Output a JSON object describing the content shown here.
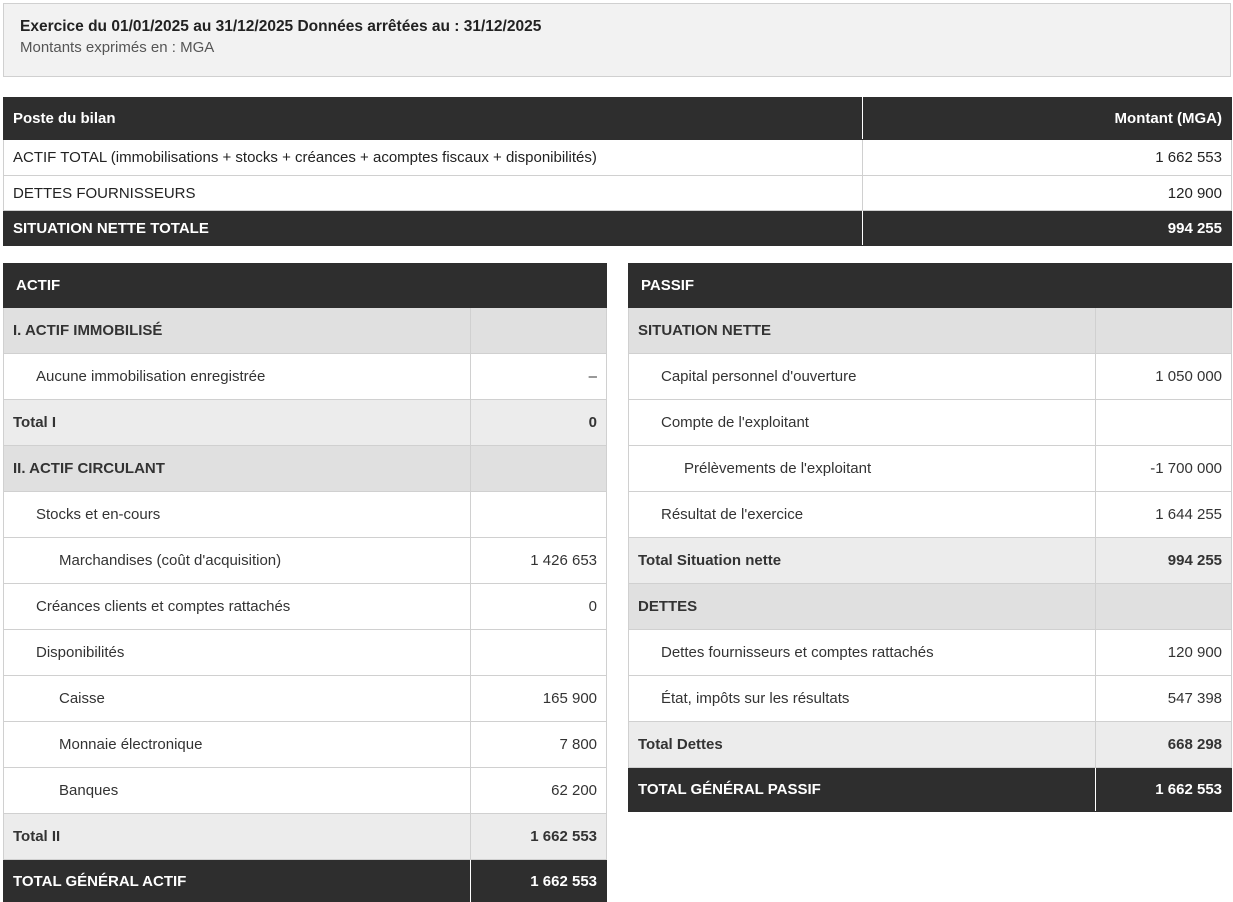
{
  "header": {
    "line1": "Exercice du 01/01/2025 au 31/12/2025 Données arrêtées au : 31/12/2025",
    "line2": "Montants exprimés en : MGA"
  },
  "summary": {
    "col_label": "Poste du bilan",
    "col_amount": "Montant (MGA)",
    "rows": [
      {
        "label": "ACTIF TOTAL (immobilisations + stocks + créances + acomptes fiscaux + disponibilités)",
        "amount": "1 662 553"
      },
      {
        "label": "DETTES FOURNISSEURS",
        "amount": "120 900"
      }
    ],
    "total": {
      "label": "SITUATION NETTE TOTALE",
      "amount": "994 255"
    }
  },
  "actif": {
    "title": "ACTIF",
    "rows": [
      {
        "label": "I. ACTIF IMMOBILISÉ",
        "amount": ""
      },
      {
        "label": "Aucune immobilisation enregistrée",
        "amount": "–"
      },
      {
        "label": "Total I",
        "amount": "0"
      },
      {
        "label": "II. ACTIF CIRCULANT",
        "amount": ""
      },
      {
        "label": "Stocks et en-cours",
        "amount": ""
      },
      {
        "label": "Marchandises (coût d'acquisition)",
        "amount": "1 426 653"
      },
      {
        "label": "Créances clients et comptes rattachés",
        "amount": "0"
      },
      {
        "label": "Disponibilités",
        "amount": ""
      },
      {
        "label": "Caisse",
        "amount": "165 900"
      },
      {
        "label": "Monnaie électronique",
        "amount": "7 800"
      },
      {
        "label": "Banques",
        "amount": "62 200"
      },
      {
        "label": "Total II",
        "amount": "1 662 553"
      },
      {
        "label": "TOTAL GÉNÉRAL ACTIF",
        "amount": "1 662 553"
      }
    ]
  },
  "passif": {
    "title": "PASSIF",
    "rows": [
      {
        "label": "SITUATION NETTE",
        "amount": ""
      },
      {
        "label": "Capital personnel d'ouverture",
        "amount": "1 050 000"
      },
      {
        "label": "Compte de l'exploitant",
        "amount": ""
      },
      {
        "label": "Prélèvements de l'exploitant",
        "amount": "-1 700 000"
      },
      {
        "label": "Résultat de l'exercice",
        "amount": "1 644 255"
      },
      {
        "label": "Total Situation nette",
        "amount": "994 255"
      },
      {
        "label": "DETTES",
        "amount": ""
      },
      {
        "label": "Dettes fournisseurs et comptes rattachés",
        "amount": "120 900"
      },
      {
        "label": "État, impôts sur les résultats",
        "amount": "547 398"
      },
      {
        "label": "Total Dettes",
        "amount": "668 298"
      },
      {
        "label": "TOTAL GÉNÉRAL PASSIF",
        "amount": "1 662 553"
      }
    ]
  }
}
